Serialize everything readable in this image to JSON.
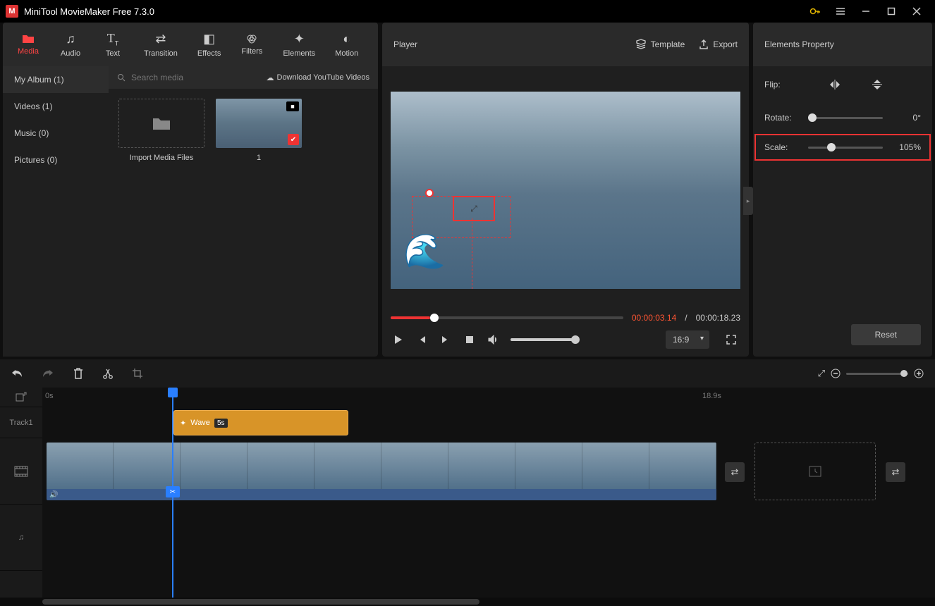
{
  "app": {
    "title": "MiniTool MovieMaker Free 7.3.0"
  },
  "topTabs": [
    {
      "label": "Media"
    },
    {
      "label": "Audio"
    },
    {
      "label": "Text"
    },
    {
      "label": "Transition"
    },
    {
      "label": "Effects"
    },
    {
      "label": "Filters"
    },
    {
      "label": "Elements"
    },
    {
      "label": "Motion"
    }
  ],
  "mediaSidebar": {
    "album": "My Album (1)",
    "videos": "Videos (1)",
    "music": "Music (0)",
    "pictures": "Pictures (0)"
  },
  "mediaList": {
    "searchPlaceholder": "Search media",
    "downloadLink": "Download YouTube Videos",
    "importLabel": "Import Media Files",
    "item1": "1"
  },
  "player": {
    "title": "Player",
    "templateBtn": "Template",
    "exportBtn": "Export",
    "currentTime": "00:00:03.14",
    "sep": "/",
    "totalTime": "00:00:18.23",
    "ratio": "16:9"
  },
  "props": {
    "title": "Elements Property",
    "flipLabel": "Flip:",
    "rotateLabel": "Rotate:",
    "rotateValue": "0°",
    "scaleLabel": "Scale:",
    "scaleValue": "105%",
    "resetBtn": "Reset"
  },
  "timeline": {
    "startMark": "0s",
    "endMark": "18.9s",
    "track1Label": "Track1",
    "elementClip": {
      "name": "Wave",
      "duration": "5s"
    }
  }
}
